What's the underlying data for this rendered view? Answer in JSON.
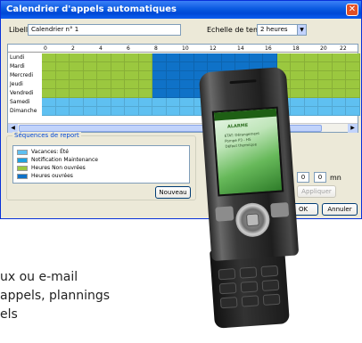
{
  "window": {
    "title": "Calendrier d'appels automatiques",
    "close_glyph": "✕"
  },
  "form": {
    "libelle_label": "Libellé",
    "libelle_value": "Calendrier n° 1",
    "echelle_label": "Echelle de temps",
    "echelle_value": "2 heures"
  },
  "grid": {
    "hours": [
      "0",
      "2",
      "4",
      "6",
      "8",
      "10",
      "12",
      "14",
      "16",
      "18",
      "20",
      "22"
    ],
    "days": [
      "Lundi",
      "Mardi",
      "Mercredi",
      "Jeudi",
      "Vendredi",
      "Samedi",
      "Dimanche"
    ],
    "colors": {
      "green": "#9bc83f",
      "blue": "#0f72c8",
      "cyan": "#5fc0f1"
    }
  },
  "sequences": {
    "title": "Séquences de report",
    "items": [
      {
        "label": "Vacances: Été",
        "color": "#5fc0f1"
      },
      {
        "label": "Notification Maintenance",
        "color": "#1ea2e0"
      },
      {
        "label": "Heures Non ouvrées",
        "color": "#9bc83f"
      },
      {
        "label": "Heures ouvrées",
        "color": "#0f72c8"
      }
    ],
    "nouveau_label": "Nouveau"
  },
  "right_panel": {
    "from_value": "0",
    "to_value": "0",
    "to_unit": "mn",
    "appliquer_label": "Appliquer",
    "ok_label": "OK",
    "annuler_label": "Annuler"
  },
  "phone_screen": {
    "title": "ALARME",
    "lines": [
      "ETAT: Dérangement",
      "Pompe P3 - HS",
      "Défaut thermique"
    ]
  },
  "caption": {
    "line1": "ux ou e-mail",
    "line2": "appels, plannings",
    "line3": "els"
  }
}
